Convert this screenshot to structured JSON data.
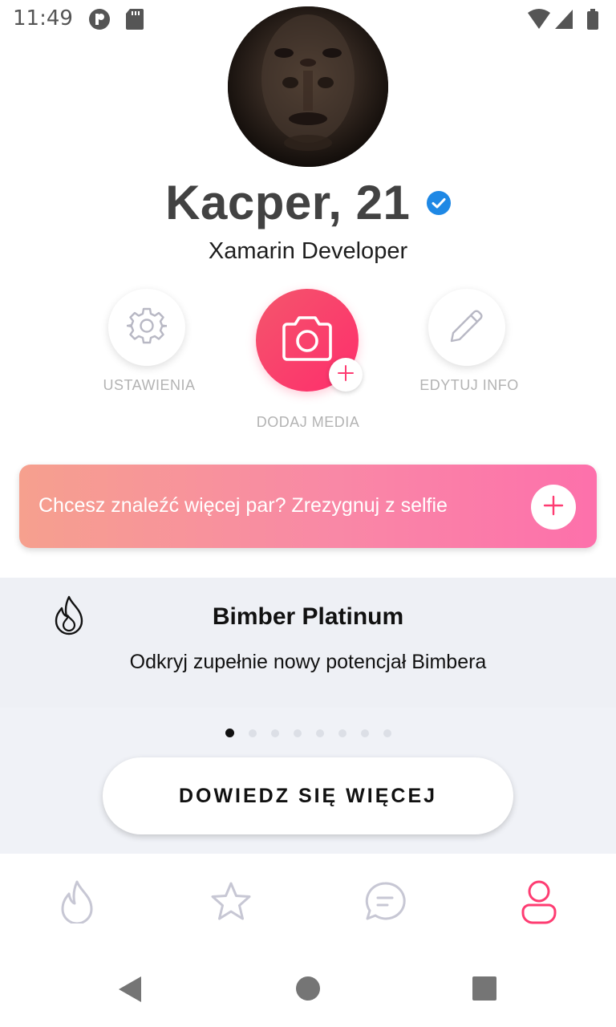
{
  "status_bar": {
    "time": "11:49",
    "icons": [
      "app-notification-icon",
      "sd-card-icon",
      "wifi-icon",
      "cell-signal-icon",
      "battery-icon"
    ]
  },
  "profile": {
    "name_age": "Kacper, 21",
    "job": "Xamarin Developer",
    "verified": true
  },
  "actions": {
    "settings_label": "USTAWIENIA",
    "add_media_label": "DODAJ MEDIA",
    "edit_info_label": "EDYTUJ INFO"
  },
  "promo": {
    "text": "Chcesz znaleźć więcej par? Zrezygnuj z selfie"
  },
  "platinum": {
    "title": "Bimber Platinum",
    "subtitle": "Odkryj zupełnie nowy potencjał Bimbera",
    "page_count": 8,
    "active_page": 0,
    "button_label": "DOWIEDZ SIĘ WIĘCEJ"
  },
  "tabs": [
    {
      "name": "swipe",
      "icon": "flame-icon",
      "active": false
    },
    {
      "name": "favorites",
      "icon": "star-icon",
      "active": false
    },
    {
      "name": "messages",
      "icon": "chat-icon",
      "active": false
    },
    {
      "name": "profile",
      "icon": "profile-icon",
      "active": true
    }
  ],
  "colors": {
    "accent": "#fe3c72",
    "inactive_tab": "#c7c7d4",
    "muted_label": "#b3b3b3",
    "verified_blue": "#1e88e5"
  }
}
